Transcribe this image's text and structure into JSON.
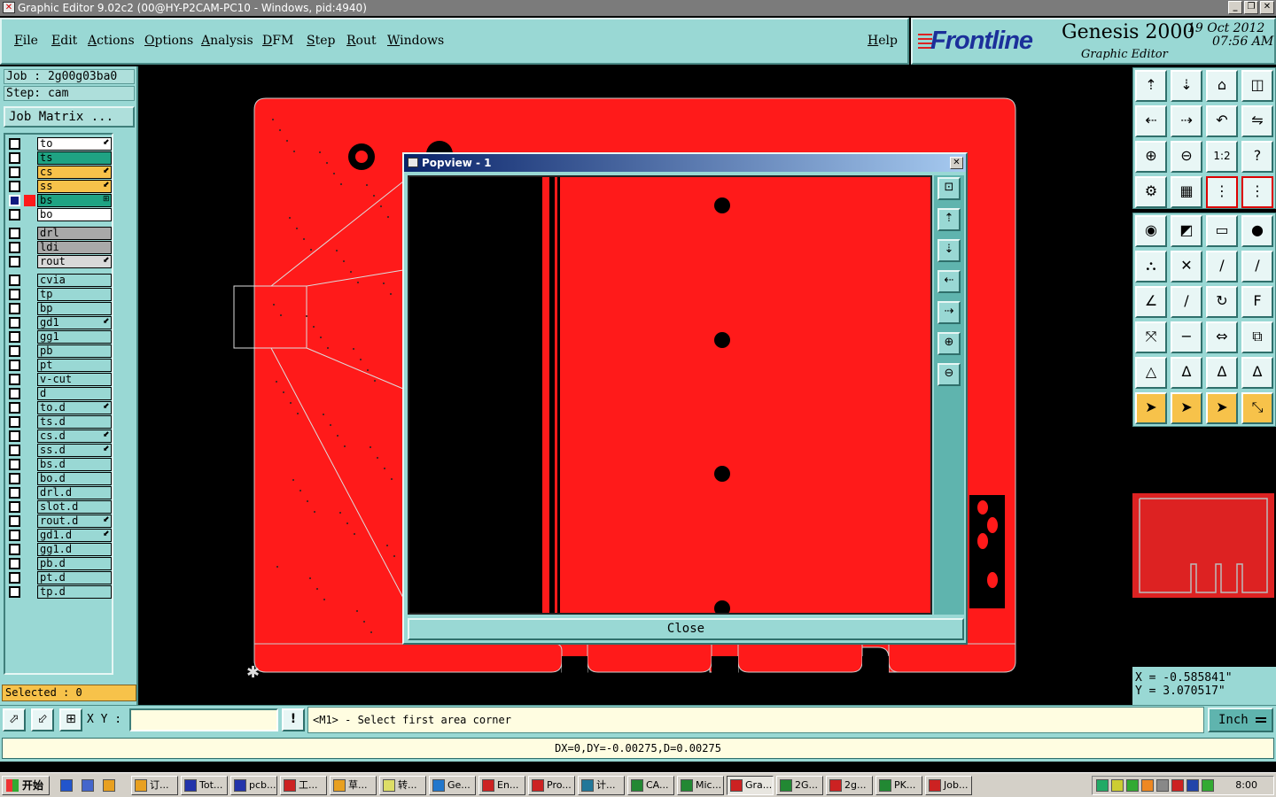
{
  "window": {
    "title": "Graphic Editor 9.02c2 (00@HY-P2CAM-PC10 - Windows, pid:4940)",
    "controls": [
      "_",
      "❐",
      "✕"
    ]
  },
  "menu": {
    "items": [
      "File",
      "Edit",
      "Actions",
      "Options",
      "Analysis",
      "DFM",
      "Step",
      "Rout",
      "Windows"
    ],
    "help": "Help"
  },
  "brand": {
    "logo": "Frontline",
    "product": "Genesis 2000",
    "subtitle": "Graphic Editor",
    "date": "19 Oct 2012",
    "time": "07:56 AM"
  },
  "job": {
    "job_line": "Job : 2g00g03ba0",
    "step_line": "Step: cam",
    "matrix_button": "Job Matrix ..."
  },
  "layers": [
    {
      "name": "to",
      "color": "#ffffff",
      "mark": "⬋",
      "group": 1,
      "active": false,
      "swatch": ""
    },
    {
      "name": "ts",
      "color": "#1fa383",
      "mark": "",
      "group": 1,
      "active": false,
      "swatch": ""
    },
    {
      "name": "cs",
      "color": "#f7c24a",
      "mark": "⬋",
      "group": 1,
      "active": false,
      "swatch": ""
    },
    {
      "name": "ss",
      "color": "#f7c24a",
      "mark": "⬋",
      "group": 1,
      "active": false,
      "swatch": ""
    },
    {
      "name": "bs",
      "color": "#1fa383",
      "mark": "⊞",
      "group": 1,
      "active": true,
      "swatch": "#ff1a1a"
    },
    {
      "name": "bo",
      "color": "#ffffff",
      "mark": "",
      "group": 1,
      "active": false,
      "swatch": ""
    },
    {
      "name": "drl",
      "color": "#a9a9a9",
      "mark": "",
      "group": 2,
      "active": false,
      "swatch": ""
    },
    {
      "name": "ldi",
      "color": "#a9a9a9",
      "mark": "",
      "group": 2,
      "active": false,
      "swatch": ""
    },
    {
      "name": "rout",
      "color": "#d9d9d9",
      "mark": "⬋",
      "group": 2,
      "active": false,
      "swatch": ""
    },
    {
      "name": "cvia",
      "color": "#99d8d4",
      "mark": "",
      "group": 3,
      "active": false,
      "swatch": ""
    },
    {
      "name": "tp",
      "color": "#99d8d4",
      "mark": "",
      "group": 3,
      "active": false,
      "swatch": ""
    },
    {
      "name": "bp",
      "color": "#99d8d4",
      "mark": "",
      "group": 3,
      "active": false,
      "swatch": ""
    },
    {
      "name": "gd1",
      "color": "#99d8d4",
      "mark": "⬋",
      "group": 3,
      "active": false,
      "swatch": ""
    },
    {
      "name": "gg1",
      "color": "#99d8d4",
      "mark": "",
      "group": 3,
      "active": false,
      "swatch": ""
    },
    {
      "name": "pb",
      "color": "#99d8d4",
      "mark": "",
      "group": 3,
      "active": false,
      "swatch": ""
    },
    {
      "name": "pt",
      "color": "#99d8d4",
      "mark": "",
      "group": 3,
      "active": false,
      "swatch": ""
    },
    {
      "name": "v-cut",
      "color": "#99d8d4",
      "mark": "",
      "group": 3,
      "active": false,
      "swatch": ""
    },
    {
      "name": "d",
      "color": "#99d8d4",
      "mark": "",
      "group": 3,
      "active": false,
      "swatch": ""
    },
    {
      "name": "to.d",
      "color": "#99d8d4",
      "mark": "⬋",
      "group": 3,
      "active": false,
      "swatch": ""
    },
    {
      "name": "ts.d",
      "color": "#99d8d4",
      "mark": "",
      "group": 3,
      "active": false,
      "swatch": ""
    },
    {
      "name": "cs.d",
      "color": "#99d8d4",
      "mark": "⬋",
      "group": 3,
      "active": false,
      "swatch": ""
    },
    {
      "name": "ss.d",
      "color": "#99d8d4",
      "mark": "⬋",
      "group": 3,
      "active": false,
      "swatch": ""
    },
    {
      "name": "bs.d",
      "color": "#99d8d4",
      "mark": "",
      "group": 3,
      "active": false,
      "swatch": ""
    },
    {
      "name": "bo.d",
      "color": "#99d8d4",
      "mark": "",
      "group": 3,
      "active": false,
      "swatch": ""
    },
    {
      "name": "drl.d",
      "color": "#99d8d4",
      "mark": "",
      "group": 3,
      "active": false,
      "swatch": ""
    },
    {
      "name": "slot.d",
      "color": "#99d8d4",
      "mark": "",
      "group": 3,
      "active": false,
      "swatch": ""
    },
    {
      "name": "rout.d",
      "color": "#99d8d4",
      "mark": "⬋",
      "group": 3,
      "active": false,
      "swatch": ""
    },
    {
      "name": "gd1.d",
      "color": "#99d8d4",
      "mark": "⬋",
      "group": 3,
      "active": false,
      "swatch": ""
    },
    {
      "name": "gg1.d",
      "color": "#99d8d4",
      "mark": "",
      "group": 3,
      "active": false,
      "swatch": ""
    },
    {
      "name": "pb.d",
      "color": "#99d8d4",
      "mark": "",
      "group": 3,
      "active": false,
      "swatch": ""
    },
    {
      "name": "pt.d",
      "color": "#99d8d4",
      "mark": "",
      "group": 3,
      "active": false,
      "swatch": ""
    },
    {
      "name": "tp.d",
      "color": "#99d8d4",
      "mark": "",
      "group": 3,
      "active": false,
      "swatch": ""
    }
  ],
  "selected": "Selected : 0",
  "popview": {
    "title": "Popview - 1",
    "close_button": "Close",
    "tools": [
      "zoom-fit-icon",
      "pan-up-icon",
      "pan-down-icon",
      "pan-left-icon",
      "pan-right-icon",
      "zoom-in-icon",
      "zoom-out-icon"
    ]
  },
  "toolbox": {
    "groups": [
      [
        {
          "icon": "pan-up-icon",
          "glyph": "⇡",
          "style": ""
        },
        {
          "icon": "pan-down-icon",
          "glyph": "⇣",
          "style": ""
        },
        {
          "icon": "home-icon",
          "glyph": "⌂",
          "style": ""
        },
        {
          "icon": "split-view-icon",
          "glyph": "◫",
          "style": ""
        },
        {
          "icon": "pan-left-icon",
          "glyph": "⇠",
          "style": ""
        },
        {
          "icon": "pan-right-icon",
          "glyph": "⇢",
          "style": ""
        },
        {
          "icon": "undo-view-icon",
          "glyph": "↶",
          "style": ""
        },
        {
          "icon": "redo-view-icon",
          "glyph": "⇋",
          "style": ""
        },
        {
          "icon": "zoom-in-icon",
          "glyph": "⊕",
          "style": ""
        },
        {
          "icon": "zoom-out-icon",
          "glyph": "⊖",
          "style": ""
        },
        {
          "icon": "scale-1-2-icon",
          "glyph": "1:2",
          "style": ""
        },
        {
          "icon": "help-icon",
          "glyph": "?",
          "style": ""
        },
        {
          "icon": "tools-icon",
          "glyph": "⚙",
          "style": ""
        },
        {
          "icon": "grid-icon",
          "glyph": "▦",
          "style": ""
        },
        {
          "icon": "snap-icon",
          "glyph": "⋮",
          "style": "rd"
        },
        {
          "icon": "snap-settings-icon",
          "glyph": "⋮",
          "style": "rd"
        }
      ],
      [
        {
          "icon": "pad-select-icon",
          "glyph": "◉",
          "style": ""
        },
        {
          "icon": "measure-icon",
          "glyph": "◩",
          "style": ""
        },
        {
          "icon": "ruler-icon",
          "glyph": "▭",
          "style": ""
        },
        {
          "icon": "pad-icon",
          "glyph": "●",
          "style": ""
        },
        {
          "icon": "net-icon",
          "glyph": "⛬",
          "style": ""
        },
        {
          "icon": "delete-icon",
          "glyph": "✕",
          "style": ""
        },
        {
          "icon": "line-icon",
          "glyph": "∕",
          "style": ""
        },
        {
          "icon": "line-ext-icon",
          "glyph": "∕",
          "style": ""
        },
        {
          "icon": "angle-icon",
          "glyph": "∠",
          "style": ""
        },
        {
          "icon": "diagonal-icon",
          "glyph": "∕",
          "style": ""
        },
        {
          "icon": "arc-icon",
          "glyph": "↻",
          "style": ""
        },
        {
          "icon": "text-icon",
          "glyph": "F",
          "style": ""
        },
        {
          "icon": "move-icon",
          "glyph": "⤧",
          "style": ""
        },
        {
          "icon": "minus-icon",
          "glyph": "−",
          "style": ""
        },
        {
          "icon": "align-icon",
          "glyph": "⇔",
          "style": ""
        },
        {
          "icon": "copy-icon",
          "glyph": "⧉",
          "style": ""
        },
        {
          "icon": "triangle-icon",
          "glyph": "△",
          "style": ""
        },
        {
          "icon": "triangle-a-icon",
          "glyph": "Δ",
          "style": ""
        },
        {
          "icon": "triangle-b-icon",
          "glyph": "Δ",
          "style": ""
        },
        {
          "icon": "triangle-c-icon",
          "glyph": "Δ",
          "style": ""
        },
        {
          "icon": "pointer-icon",
          "glyph": "➤",
          "style": "hl"
        },
        {
          "icon": "select-icon",
          "glyph": "➤",
          "style": "hl"
        },
        {
          "icon": "select-area-icon",
          "glyph": "➤",
          "style": "hl"
        },
        {
          "icon": "route-icon",
          "glyph": "⤡",
          "style": "hl"
        }
      ]
    ],
    "coords": {
      "x": "X = -0.585841\"",
      "y": "Y = 3.070517\""
    }
  },
  "command": {
    "xy_label": "X Y :",
    "xy_value": "",
    "prompt": "<M1> - Select first area corner",
    "units": "Inch"
  },
  "status": "DX=0,DY=-0.00275,D=0.00275",
  "taskbar": {
    "start": "开始",
    "tasks": [
      {
        "label": "订...",
        "color": "#e8a020"
      },
      {
        "label": "Tot...",
        "color": "#2233aa"
      },
      {
        "label": "pcb...",
        "color": "#2233aa"
      },
      {
        "label": "工...",
        "color": "#cc2222"
      },
      {
        "label": "草...",
        "color": "#e8a020"
      },
      {
        "label": "转...",
        "color": "#dddd66"
      },
      {
        "label": "Ge...",
        "color": "#2277cc"
      },
      {
        "label": "En...",
        "color": "#cc2222"
      },
      {
        "label": "Pro...",
        "color": "#cc2222"
      },
      {
        "label": "计...",
        "color": "#227799"
      },
      {
        "label": "CA...",
        "color": "#228833"
      },
      {
        "label": "Mic...",
        "color": "#228833"
      },
      {
        "label": "Gra...",
        "color": "#cc2222",
        "active": true
      },
      {
        "label": "2G...",
        "color": "#228833"
      },
      {
        "label": "2g...",
        "color": "#cc2222"
      },
      {
        "label": "PK...",
        "color": "#228833"
      },
      {
        "label": "Job...",
        "color": "#cc2222"
      }
    ],
    "clock": "8:00"
  }
}
